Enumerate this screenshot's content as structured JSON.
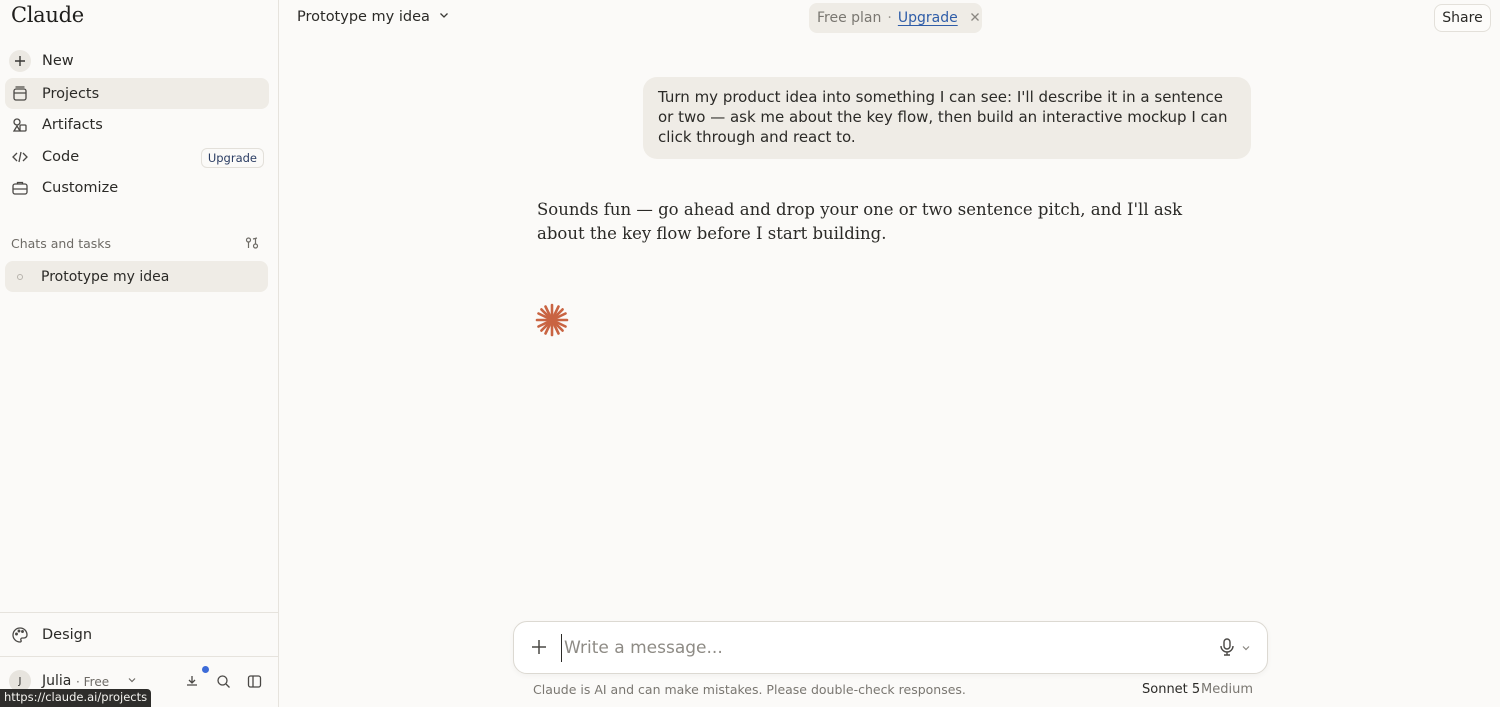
{
  "app": {
    "logo": "Claude"
  },
  "sidebar": {
    "nav": [
      {
        "label": "New",
        "icon": "plus-icon"
      },
      {
        "label": "Projects",
        "icon": "projects-icon"
      },
      {
        "label": "Artifacts",
        "icon": "artifacts-icon"
      },
      {
        "label": "Code",
        "icon": "code-icon",
        "badge": "Upgrade"
      },
      {
        "label": "Customize",
        "icon": "briefcase-icon"
      }
    ],
    "section_label": "Chats and tasks",
    "chats": [
      {
        "label": "Prototype my idea"
      }
    ],
    "design_label": "Design",
    "user": {
      "initial": "J",
      "name": "Julia",
      "plan": "· Free"
    },
    "status_url": "https://claude.ai/projects"
  },
  "header": {
    "chat_title": "Prototype my idea",
    "plan_label": "Free plan",
    "plan_separator": "·",
    "upgrade_label": "Upgrade",
    "share_label": "Share"
  },
  "conversation": {
    "user_message": "Turn my product idea into something I can see: I'll describe it in a sentence or two — ask me about the key flow, then build an interactive mockup I can click through and react to.",
    "assistant_message": "Sounds fun — go ahead and drop your one or two sentence pitch, and I'll ask about the key flow before I start building."
  },
  "composer": {
    "placeholder": "Write a message...",
    "disclaimer": "Claude is AI and can make mistakes. Please double-check responses.",
    "model_name": "Sonnet 5",
    "model_effort": "Medium"
  },
  "colors": {
    "accent_link": "#2f5da8",
    "spark": "#c96442",
    "notification": "#3c6bd8"
  }
}
